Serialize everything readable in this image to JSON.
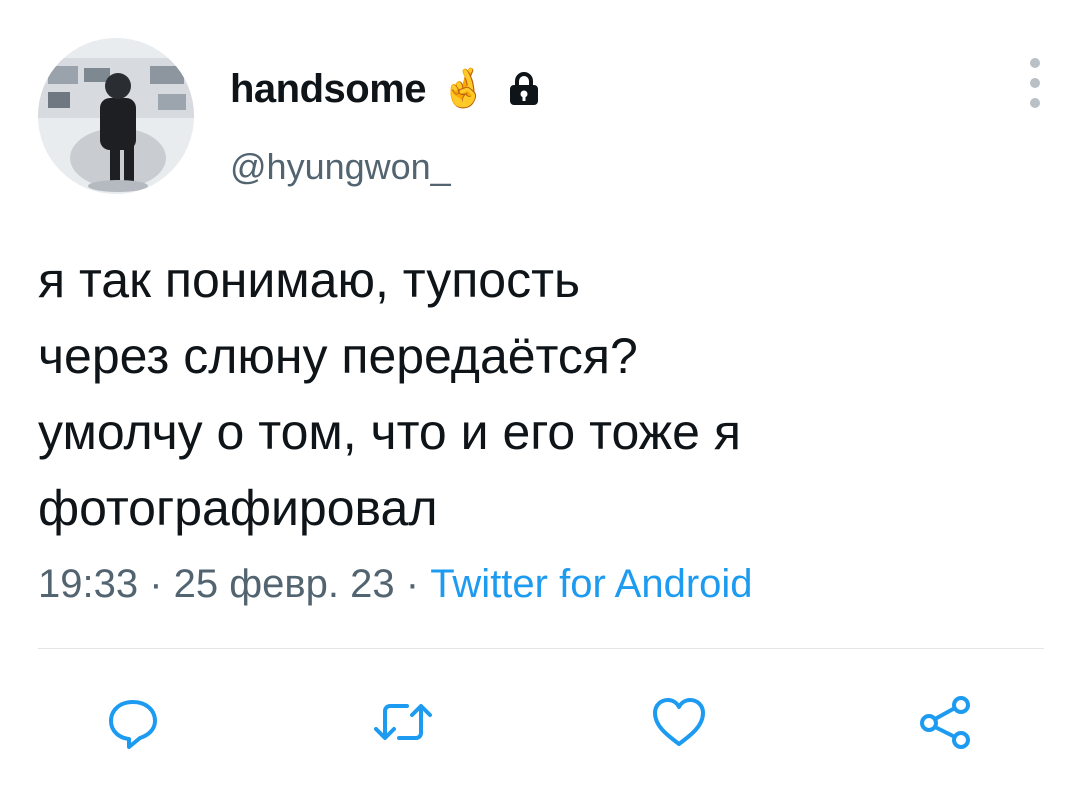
{
  "user": {
    "display_name": "handsome",
    "emoji": "🤞",
    "handle": "@hyungwon_"
  },
  "tweet": {
    "lines": [
      "я так понимаю, тупость",
      "через слюну передаётся?",
      "умолчу о том, что и его тоже я",
      "фотографировал"
    ],
    "time": "19:33",
    "separator": " · ",
    "date": "25 февр. 23",
    "source": "Twitter for Android"
  },
  "colors": {
    "text": "#0f1419",
    "secondary": "#536471",
    "link": "#1d9bf0",
    "icon": "#1d9bf0"
  },
  "icons": {
    "avatar": "profile-photo",
    "lock": "lock-icon",
    "more": "vertical-dots-icon",
    "reply": "reply-icon",
    "retweet": "retweet-icon",
    "like": "heart-icon",
    "share": "share-icon"
  }
}
